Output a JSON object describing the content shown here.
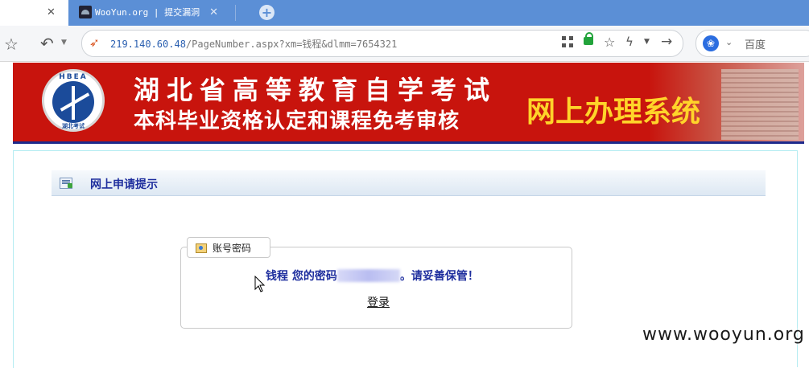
{
  "browser": {
    "tabs": [
      {
        "label": "",
        "active": true
      },
      {
        "label": "WooYun.org | 提交漏洞",
        "active": false
      }
    ],
    "address": {
      "host": "219.140.60.48",
      "path": "/PageNumber.aspx?xm=钱程&dlmm=7654321"
    },
    "search_engine": "百度",
    "icons": [
      "favorite-star-icon",
      "undo-icon",
      "rocket-icon",
      "qr-code-icon",
      "lock-icon",
      "star-icon",
      "bolt-icon",
      "go-arrow-icon",
      "baidu-paw-icon",
      "new-tab-icon"
    ]
  },
  "banner": {
    "logo_text": "HBEA",
    "logo_sub": "湖北考试",
    "title_line1": "湖北省高等教育自学考试",
    "title_line2": "本科毕业资格认定和课程免考审核",
    "system_name": "网上办理系统"
  },
  "section": {
    "title": "网上申请提示"
  },
  "panel": {
    "legend": "账号密码",
    "name": "钱程",
    "message_prefix": " 您的密码",
    "message_suffix": "。请妥善保管！",
    "login_link": "登录"
  },
  "watermark": "www.wooyun.org",
  "colors": {
    "banner_red": "#c8140d",
    "title_blue": "#1f2f9e",
    "system_yellow": "#ffd42a",
    "tabstrip_blue": "#5b8fd6"
  }
}
